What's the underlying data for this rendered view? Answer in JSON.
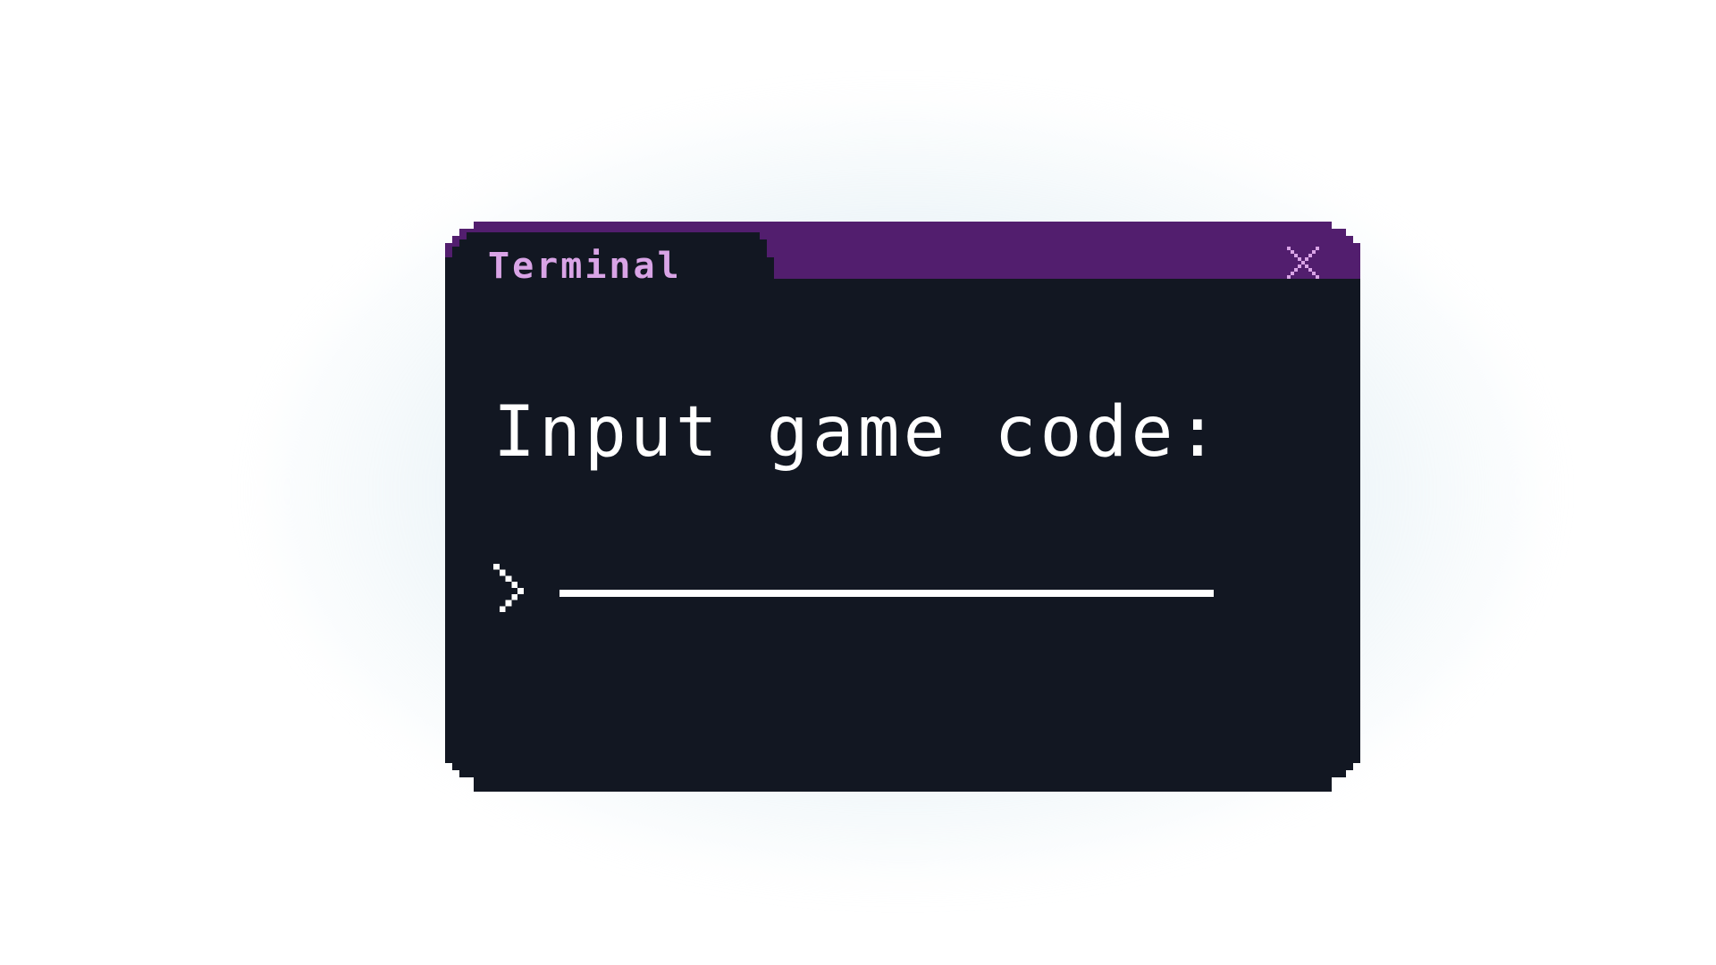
{
  "window": {
    "tab_title": "Terminal",
    "close_icon": "close-icon"
  },
  "content": {
    "prompt_label": "Input game code:",
    "caret_icon": "chevron-right-icon",
    "code_input": {
      "value": "",
      "placeholder": ""
    }
  },
  "colors": {
    "title_bar": "#521e6e",
    "body": "#121722",
    "tab_text": "#d9a4e6",
    "close_icon": "#d9a4e6",
    "prompt_text": "#ffffff",
    "input_line": "#ffffff"
  }
}
